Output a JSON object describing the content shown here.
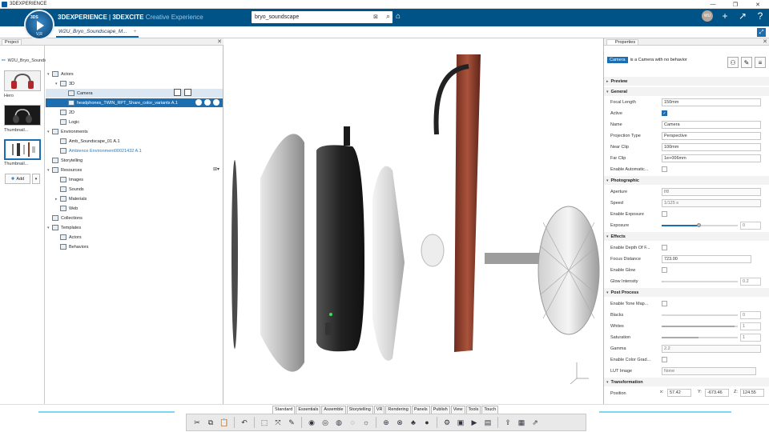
{
  "window": {
    "app_title": "3DEXPERIENCE",
    "controls": [
      "—",
      "❐",
      "✕"
    ]
  },
  "topbar": {
    "brand_bold": "3DEXPERIENCE",
    "brand_sep": " | ",
    "brand_app": "3DEXCITE",
    "brand_sub": "Creative Experience",
    "search_value": "bryo_soundscape",
    "compass_label": "V,R",
    "user_initials": "WU"
  },
  "tabs": {
    "active_doc": "W2U_Bryo_Soundscape_M...",
    "plus": "+"
  },
  "project_panel": {
    "tab_label": "Project",
    "project_name": "W2U_Bryo_Soundscape_MassContentCreation",
    "thumbnails": [
      {
        "label": "Hero"
      },
      {
        "label": "Thumbnail..."
      },
      {
        "label": "Thumbnail..."
      }
    ],
    "add_label": "Add",
    "tree": [
      {
        "label": "Actors",
        "indent": 0,
        "twisty": "▾",
        "state": ""
      },
      {
        "label": "3D",
        "indent": 1,
        "twisty": "▾",
        "state": ""
      },
      {
        "label": "Camera",
        "indent": 2,
        "twisty": "",
        "state": "hover"
      },
      {
        "label": "headphones_TWIN_RPT_Share_color_variants A.1",
        "indent": 2,
        "twisty": "",
        "state": "sel"
      },
      {
        "label": "2D",
        "indent": 1,
        "twisty": "",
        "state": ""
      },
      {
        "label": "Logic",
        "indent": 1,
        "twisty": "",
        "state": ""
      },
      {
        "label": "Environments",
        "indent": 0,
        "twisty": "▾",
        "state": ""
      },
      {
        "label": "Amb_Soundscape_01 A.1",
        "indent": 1,
        "twisty": "",
        "state": ""
      },
      {
        "label": "Ambience Environment00021432 A.1",
        "indent": 1,
        "twisty": "",
        "state": "link"
      },
      {
        "label": "Storytelling",
        "indent": 0,
        "twisty": "",
        "state": ""
      },
      {
        "label": "Resources",
        "indent": 0,
        "twisty": "▾",
        "state": ""
      },
      {
        "label": "Images",
        "indent": 1,
        "twisty": "",
        "state": ""
      },
      {
        "label": "Sounds",
        "indent": 1,
        "twisty": "",
        "state": ""
      },
      {
        "label": "Materials",
        "indent": 1,
        "twisty": "▸",
        "state": ""
      },
      {
        "label": "Web",
        "indent": 1,
        "twisty": "",
        "state": ""
      },
      {
        "label": "Collections",
        "indent": 0,
        "twisty": "",
        "state": ""
      },
      {
        "label": "Templates",
        "indent": 0,
        "twisty": "▾",
        "state": ""
      },
      {
        "label": "Actors",
        "indent": 1,
        "twisty": "",
        "state": ""
      },
      {
        "label": "Behaviors",
        "indent": 1,
        "twisty": "",
        "state": ""
      }
    ]
  },
  "properties": {
    "tab_label": "Properties",
    "object_chip": "Camera",
    "object_desc": "is a Camera with no behavior",
    "sections": {
      "preview": "Preview",
      "general": "General",
      "photographic": "Photographic",
      "effects": "Effects",
      "post_process": "Post Process",
      "transformation": "Transformation"
    },
    "fields": {
      "focal_length": {
        "label": "Focal Length",
        "value": "150mm"
      },
      "active": {
        "label": "Active"
      },
      "name": {
        "label": "Name",
        "value": "Camera"
      },
      "projection": {
        "label": "Projection Type",
        "value": "Perspective"
      },
      "near_clip": {
        "label": "Near Clip",
        "value": "100mm"
      },
      "far_clip": {
        "label": "Far Clip",
        "value": "1e+006mm"
      },
      "enable_auto": {
        "label": "Enable Automatic..."
      },
      "aperture": {
        "label": "Aperture",
        "value": "f/8"
      },
      "speed": {
        "label": "Speed",
        "value": "1/125 s"
      },
      "enable_exposure": {
        "label": "Enable Exposure"
      },
      "exposure": {
        "label": "Exposure",
        "value": "0"
      },
      "enable_dof": {
        "label": "Enable Depth Of F..."
      },
      "focus_distance": {
        "label": "Focus Distance",
        "value": "723.00"
      },
      "enable_glow": {
        "label": "Enable Glow"
      },
      "glow_intensity": {
        "label": "Glow Intensity",
        "value": "0.2"
      },
      "enable_tone": {
        "label": "Enable Tone Map..."
      },
      "blacks": {
        "label": "Blacks",
        "value": "0"
      },
      "whites": {
        "label": "Whites",
        "value": "1"
      },
      "saturation": {
        "label": "Saturation",
        "value": "1"
      },
      "gamma": {
        "label": "Gamma",
        "value": "2.2"
      },
      "enable_color_grad": {
        "label": "Enable Color Grad..."
      },
      "lut_image": {
        "label": "LUT Image",
        "value": "None"
      },
      "position": {
        "label": "Position",
        "x_label": "x:",
        "x": "57.42",
        "y_label": "Y:",
        "y": "-673.46",
        "z_label": "Z:",
        "z": "124.55"
      }
    }
  },
  "bottom_tabs": [
    "Standard",
    "Essentials",
    "Assemble",
    "Storytelling",
    "VR",
    "Rendering",
    "Panels",
    "Publish",
    "View",
    "Tools",
    "Touch"
  ],
  "colors": {
    "topbar": "#005386",
    "accent": "#1d6eb0",
    "selection": "#1d6eb0",
    "glow": "#7fd6f2",
    "ear_cup": "#8b3a2a"
  },
  "icons": [
    "scissors-icon",
    "copy-icon",
    "paste-icon",
    "undo-icon",
    "select-icon",
    "transform-icon",
    "snap-icon",
    "render-icon",
    "material-icon",
    "environment-icon",
    "camera-icon",
    "media-icon",
    "publish-icon"
  ]
}
